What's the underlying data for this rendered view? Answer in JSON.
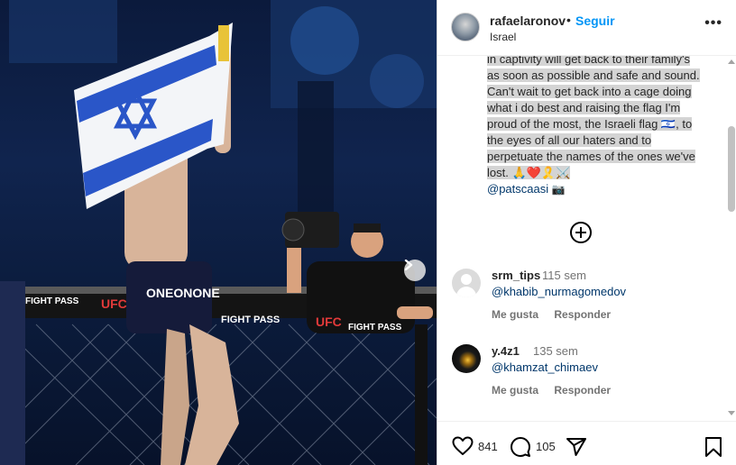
{
  "post": {
    "username": "rafaelaronov",
    "separator": "•",
    "follow_label": "Seguir",
    "location": "Israel",
    "more_label": "•••"
  },
  "caption": {
    "lines": [
      "in captivity will get back to their family's",
      "as soon as possible and safe and sound.",
      "Can't wait to get back into a cage doing",
      "what i do best and raising the flag I'm",
      "proud of the most, the Israeli flag 🇮🇱, to",
      "the eyes of all our haters and to",
      "perpetuate the names of the ones we've",
      "lost. 🙏❤️🎗️⚔️"
    ],
    "credit_mention": "@patscaasi",
    "credit_emoji": "📷"
  },
  "comments": [
    {
      "username": "srm_tips",
      "time": "115 sem",
      "text": "@khabib_nurmagomedov",
      "like_label": "Me gusta",
      "reply_label": "Responder"
    },
    {
      "username": "y.4z1",
      "time": "135 sem",
      "text": "@khamzat_chimaev",
      "like_label": "Me gusta",
      "reply_label": "Responder"
    }
  ],
  "footer": {
    "likes": "841",
    "comments": "105"
  },
  "photo": {
    "banner_ufc": "UFC",
    "banner_fightpass": "FIGHT PASS",
    "shorts_text": "ONEONONE"
  },
  "colors": {
    "accent": "#0095f6",
    "mention": "#00376b",
    "muted": "#737373"
  }
}
